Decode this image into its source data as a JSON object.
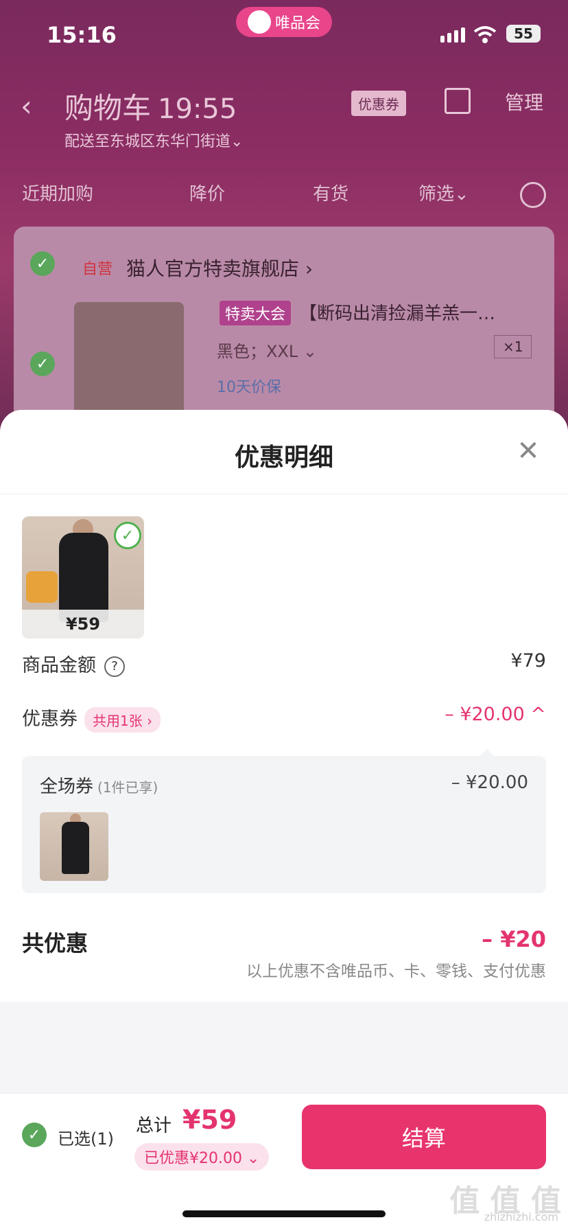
{
  "status": {
    "time": "15:16",
    "app_pill": "唯品会",
    "battery": "55"
  },
  "nav": {
    "back": "‹",
    "title": "购物车",
    "countdown": "19:55",
    "coupon_tag": "优惠券",
    "manage": "管理",
    "address": "配送至东城区东华门街道⌄"
  },
  "filters": [
    "近期加购",
    "降价",
    "有货",
    "筛选⌄"
  ],
  "cart": {
    "self_run": "自营",
    "store": "猫人官方特卖旗舰店 ›",
    "sale_tag": "特卖大会",
    "title": "【断码出清捡漏羊羔一…",
    "spec": "黑色；XXL ⌄",
    "qty": "×1",
    "guarantee": "10天价保"
  },
  "sheet": {
    "title": "优惠明细",
    "close": "✕",
    "product_price": "¥59",
    "goods_amount_label": "商品金额",
    "goods_amount": "¥79",
    "coupon_label": "优惠券",
    "coupon_share": "共用1张 ›",
    "coupon_amount": "– ¥20.00 ^",
    "panel": {
      "label": "全场券",
      "sub": "(1件已享)",
      "amount": "– ¥20.00"
    },
    "total_label": "共优惠",
    "total_amount": "– ¥20",
    "note": "以上优惠不含唯品币、卡、零钱、支付优惠"
  },
  "bottom": {
    "selected": "已选(1)",
    "sum_label": "总计",
    "sum_amount": "¥59",
    "saved": "已优惠¥20.00 ⌄",
    "pay": "结算",
    "watermark": "值 值 值",
    "watermark_url": "zhizhizhi.com"
  },
  "colors": {
    "accent": "#e4346f",
    "check": "#5aa75c"
  }
}
